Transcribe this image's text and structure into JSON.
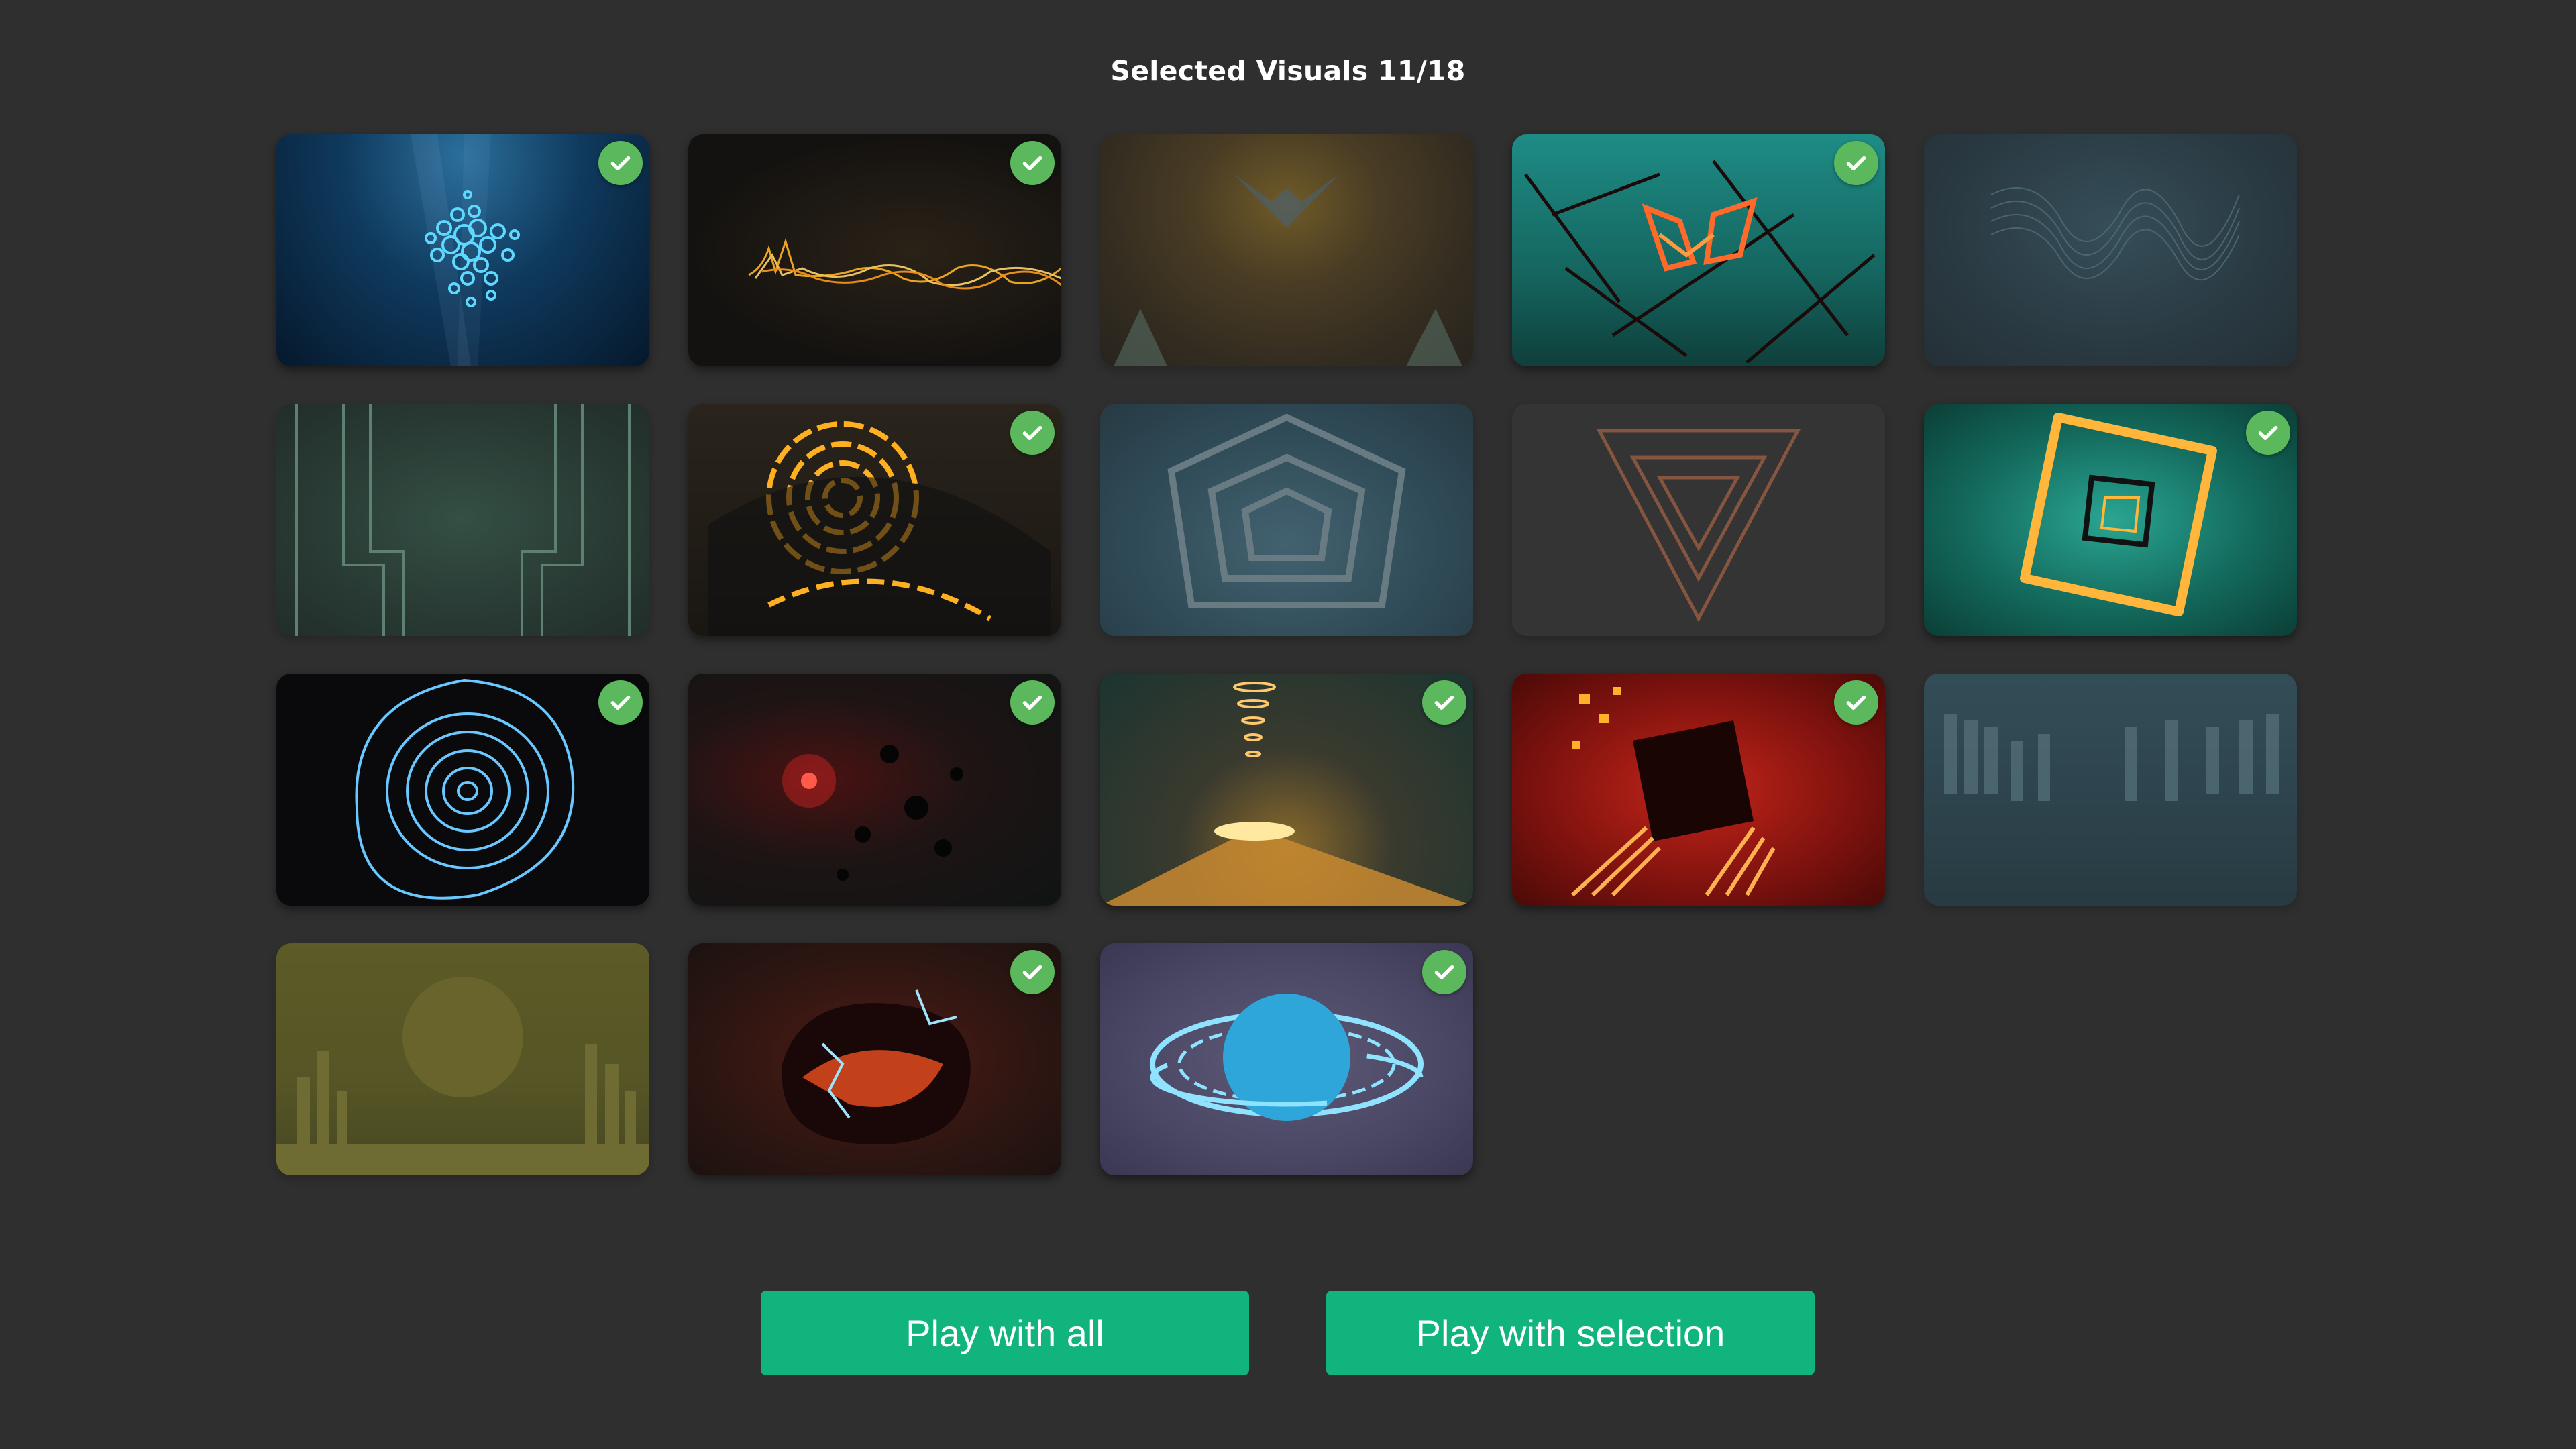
{
  "header": {
    "title": "Selected Visuals 11/18"
  },
  "tiles": [
    {
      "name": "bubbles-cluster",
      "selected": true
    },
    {
      "name": "golden-waveform",
      "selected": true
    },
    {
      "name": "fire-kaleidoscope",
      "selected": false
    },
    {
      "name": "neon-shards",
      "selected": true
    },
    {
      "name": "wire-wave",
      "selected": false
    },
    {
      "name": "green-corridor",
      "selected": false
    },
    {
      "name": "orange-rings",
      "selected": true
    },
    {
      "name": "hex-tunnel",
      "selected": false
    },
    {
      "name": "triangle-tunnel",
      "selected": false
    },
    {
      "name": "glowing-square",
      "selected": true
    },
    {
      "name": "blue-vortex",
      "selected": true
    },
    {
      "name": "red-particles",
      "selected": true
    },
    {
      "name": "gold-tornado",
      "selected": true
    },
    {
      "name": "red-pyramid",
      "selected": true
    },
    {
      "name": "equalizer-bars",
      "selected": false
    },
    {
      "name": "yellow-skyline",
      "selected": false
    },
    {
      "name": "lava-orb",
      "selected": true
    },
    {
      "name": "blue-planet",
      "selected": true
    }
  ],
  "buttons": {
    "play_all": "Play with all",
    "play_selection": "Play with selection"
  },
  "colors": {
    "accent": "#12b47e",
    "check": "#5cb85c",
    "background": "#2f2f2f"
  },
  "icons": {
    "check": "check-icon"
  }
}
